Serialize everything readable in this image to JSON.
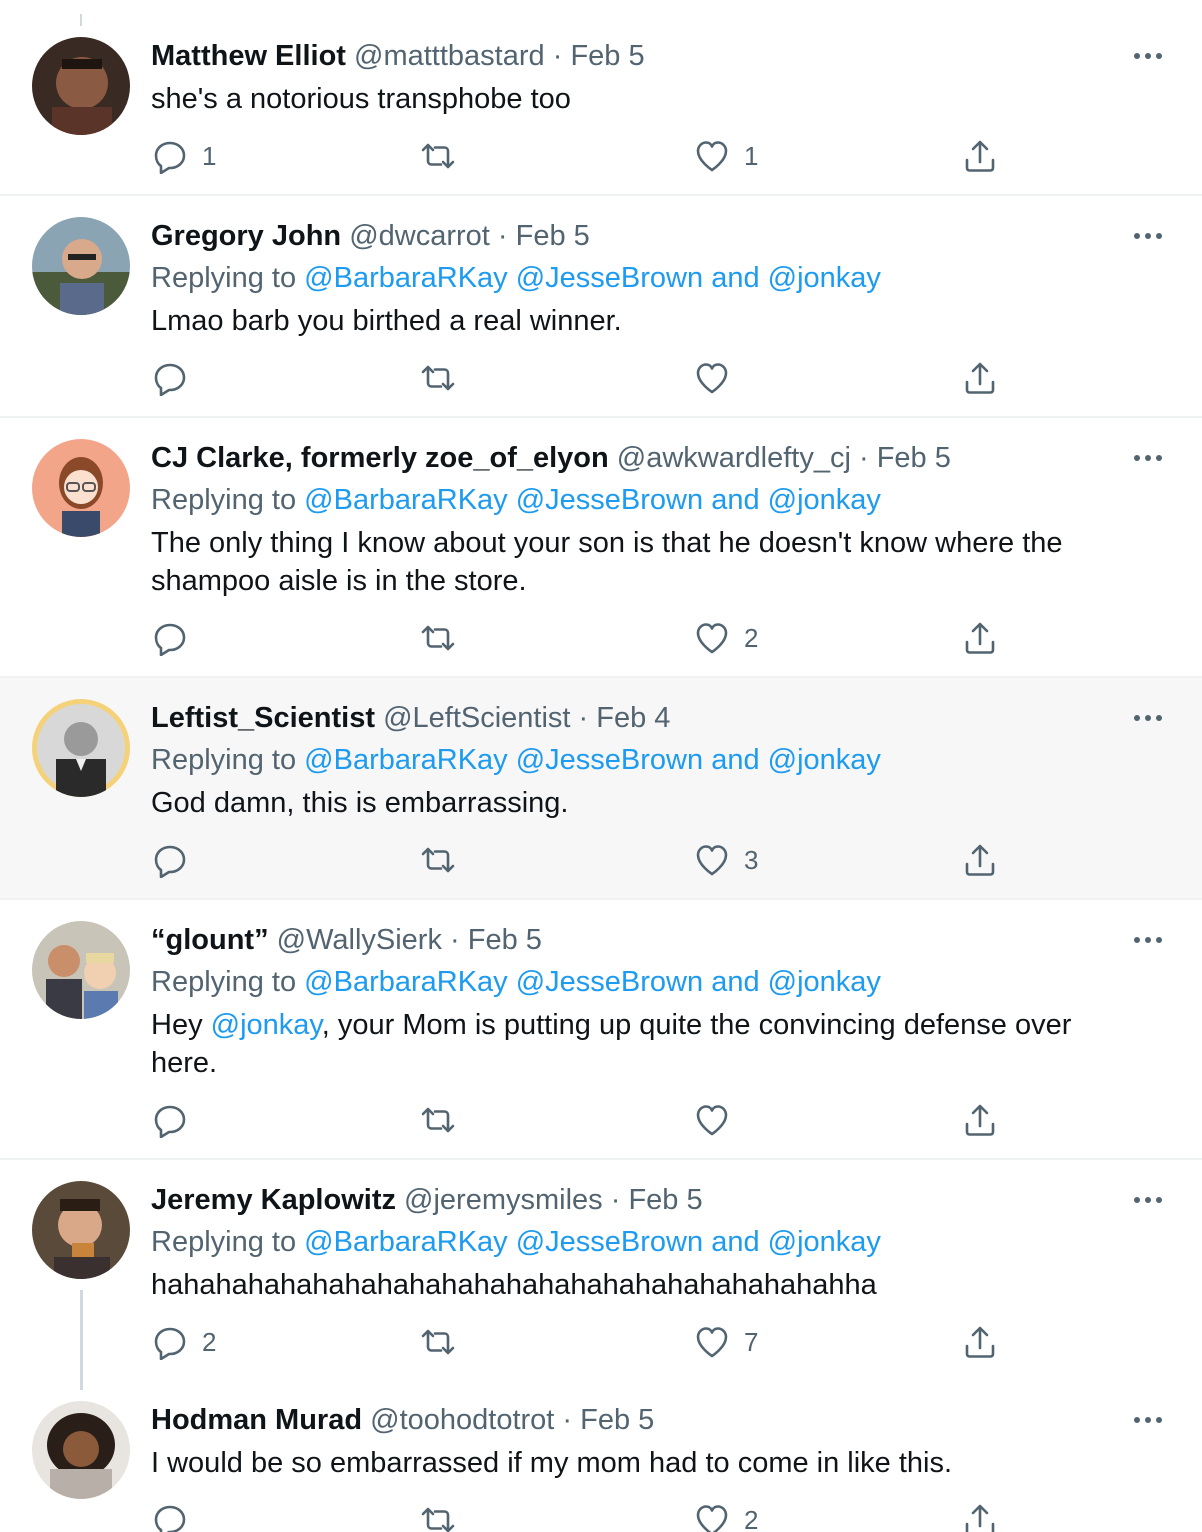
{
  "tweets": [
    {
      "name": "Matthew Elliot",
      "handle": "@matttbastard",
      "date": "Feb 5",
      "replying": null,
      "text": "she's a notorious transphobe too",
      "replies": "1",
      "retweets": "",
      "likes": "1"
    },
    {
      "name": "Gregory John",
      "handle": "@dwcarrot",
      "date": "Feb 5",
      "replying": {
        "prefix": "Replying to ",
        "mentions": "@BarbaraRKay @JesseBrown and @jonkay"
      },
      "text": "Lmao barb you birthed a real winner.",
      "replies": "",
      "retweets": "",
      "likes": ""
    },
    {
      "name": "CJ Clarke, formerly zoe_of_elyon",
      "handle": "@awkwardlefty_cj",
      "date": "Feb 5",
      "replying": {
        "prefix": "Replying to ",
        "mentions": "@BarbaraRKay @JesseBrown and @jonkay"
      },
      "text_line1": "The only thing I know about your son is that he doesn't know where the",
      "text_line2": "shampoo aisle is in the store.",
      "replies": "",
      "retweets": "",
      "likes": "2"
    },
    {
      "name": "Leftist_Scientist",
      "handle": "@LeftScientist",
      "date": "Feb 4",
      "replying": {
        "prefix": "Replying to ",
        "mentions": "@BarbaraRKay @JesseBrown and @jonkay"
      },
      "text": "God damn, this is embarrassing.",
      "replies": "",
      "retweets": "",
      "likes": "3"
    },
    {
      "name": "“glount”",
      "handle": "@WallySierk",
      "date": "Feb 5",
      "replying": {
        "prefix": "Replying to ",
        "mentions": "@BarbaraRKay @JesseBrown and @jonkay"
      },
      "text_pre": "Hey ",
      "text_mention": "@jonkay",
      "text_post": ", your Mom is putting up quite the convincing defense over",
      "text_line2": "here.",
      "replies": "",
      "retweets": "",
      "likes": ""
    },
    {
      "name": "Jeremy Kaplowitz",
      "handle": "@jeremysmiles",
      "date": "Feb 5",
      "replying": {
        "prefix": "Replying to ",
        "mentions": "@BarbaraRKay @JesseBrown and @jonkay"
      },
      "text": "hahahahahahahahahahahahahahahahahahahahahahha",
      "replies": "2",
      "retweets": "",
      "likes": "7"
    },
    {
      "name": "Hodman Murad",
      "handle": "@toohodtotrot",
      "date": "Feb 5",
      "replying": null,
      "text": "I would be so embarrassed if my mom had to come in like this.",
      "replies": "",
      "retweets": "",
      "likes": "2"
    }
  ],
  "separator": "·",
  "colors": {
    "accent": "#1d9bf0",
    "secondary_text": "#536471",
    "divider": "#eff3f4",
    "highlight_bg": "#f7f7f7"
  }
}
